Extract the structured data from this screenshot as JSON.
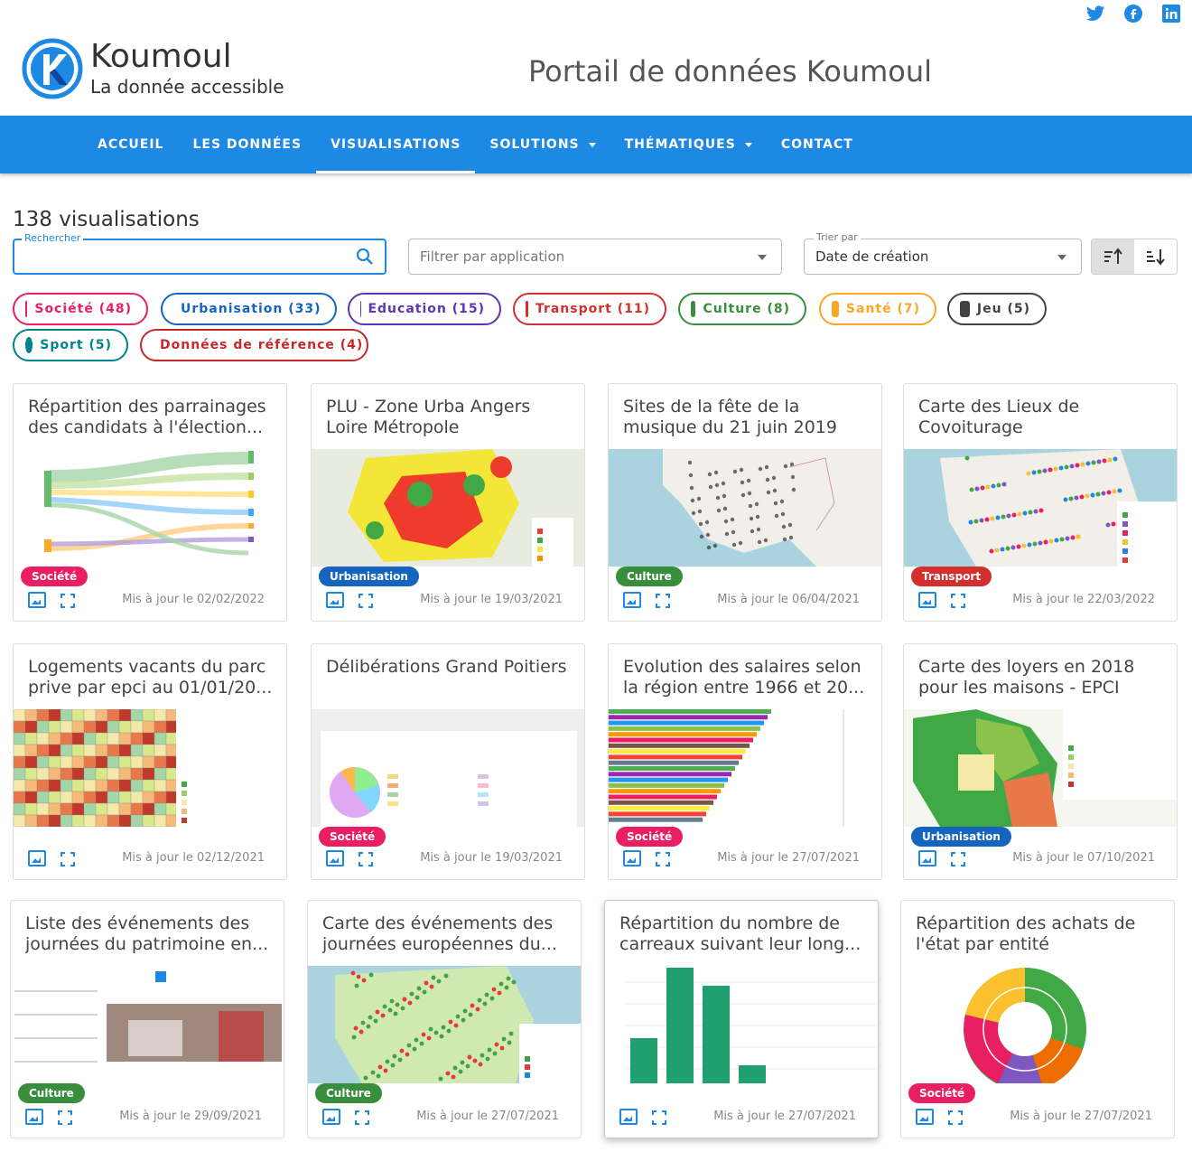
{
  "header": {
    "brand_name": "Koumoul",
    "brand_tagline": "La donnée accessible",
    "portal_title": "Portail de données Koumoul",
    "social": [
      "twitter-icon",
      "facebook-icon",
      "linkedin-icon"
    ]
  },
  "nav": {
    "items": [
      {
        "label": "ACCUEIL"
      },
      {
        "label": "LES DONNÉES"
      },
      {
        "label": "VISUALISATIONS"
      },
      {
        "label": "SOLUTIONS"
      },
      {
        "label": "THÉMATIQUES"
      },
      {
        "label": "CONTACT"
      }
    ],
    "active": "VISUALISATIONS"
  },
  "toolbar": {
    "count": "138 visualisations",
    "search_label": "Rechercher",
    "search_value": "",
    "filter_placeholder": "Filtrer par application",
    "sort_label": "Trier par",
    "sort_value": "Date de création"
  },
  "chips": [
    {
      "label": "Société (48)",
      "color": "#e91e63"
    },
    {
      "label": "Urbanisation (33)",
      "color": "#1565c0"
    },
    {
      "label": "Education (15)",
      "color": "#5e35b1"
    },
    {
      "label": "Transport (11)",
      "color": "#d32f2f"
    },
    {
      "label": "Culture (8)",
      "color": "#388e3c"
    },
    {
      "label": "Santé (7)",
      "color": "#f9a825"
    },
    {
      "label": "Jeu (5)",
      "color": "#424242"
    },
    {
      "label": "Sport (5)",
      "color": "#00838f"
    },
    {
      "label": "Données de référence (4)",
      "color": "#c62828"
    }
  ],
  "cards": [
    {
      "title": "Répartition des parrainages des candidats à l'élection...",
      "tag": "Société",
      "tag_color": "#e91e63",
      "updated": "Mis à jour le 02/02/2022"
    },
    {
      "title": "PLU - Zone Urba Angers Loire Métropole",
      "tag": "Urbanisation",
      "tag_color": "#1565c0",
      "updated": "Mis à jour le 19/03/2021"
    },
    {
      "title": "Sites de la fête de la musique du 21 juin 2019 e...",
      "tag": "Culture",
      "tag_color": "#388e3c",
      "updated": "Mis à jour le 06/04/2021"
    },
    {
      "title": "Carte des Lieux de Covoiturage",
      "tag": "Transport",
      "tag_color": "#d32f2f",
      "updated": "Mis à jour le 22/03/2022"
    },
    {
      "title": "Logements vacants du parc prive par epci au 01/01/20...",
      "tag": "",
      "tag_color": "",
      "updated": "Mis à jour le 02/12/2021"
    },
    {
      "title": "Délibérations Grand Poitiers",
      "tag": "Société",
      "tag_color": "#e91e63",
      "updated": "Mis à jour le 19/03/2021"
    },
    {
      "title": "Evolution des salaires selon la région entre 1966 et 20...",
      "tag": "Société",
      "tag_color": "#e91e63",
      "updated": "Mis à jour le 27/07/2021"
    },
    {
      "title": "Carte des loyers en 2018 pour les maisons - EPCI",
      "tag": "Urbanisation",
      "tag_color": "#1565c0",
      "updated": "Mis à jour le 07/10/2021"
    },
    {
      "title": "Liste des événements des journées du patrimoine en...",
      "tag": "Culture",
      "tag_color": "#388e3c",
      "updated": "Mis à jour le 29/09/2021"
    },
    {
      "title": "Carte des événements des journées européennes du...",
      "tag": "Culture",
      "tag_color": "#388e3c",
      "updated": "Mis à jour le 27/07/2021"
    },
    {
      "title": "Répartition du nombre de carreaux suivant leur long...",
      "tag": "",
      "tag_color": "",
      "updated": "Mis à jour le 27/07/2021"
    },
    {
      "title": "Répartition des achats de l'état par entité",
      "tag": "Société",
      "tag_color": "#e91e63",
      "updated": "Mis à jour le 27/07/2021"
    }
  ]
}
